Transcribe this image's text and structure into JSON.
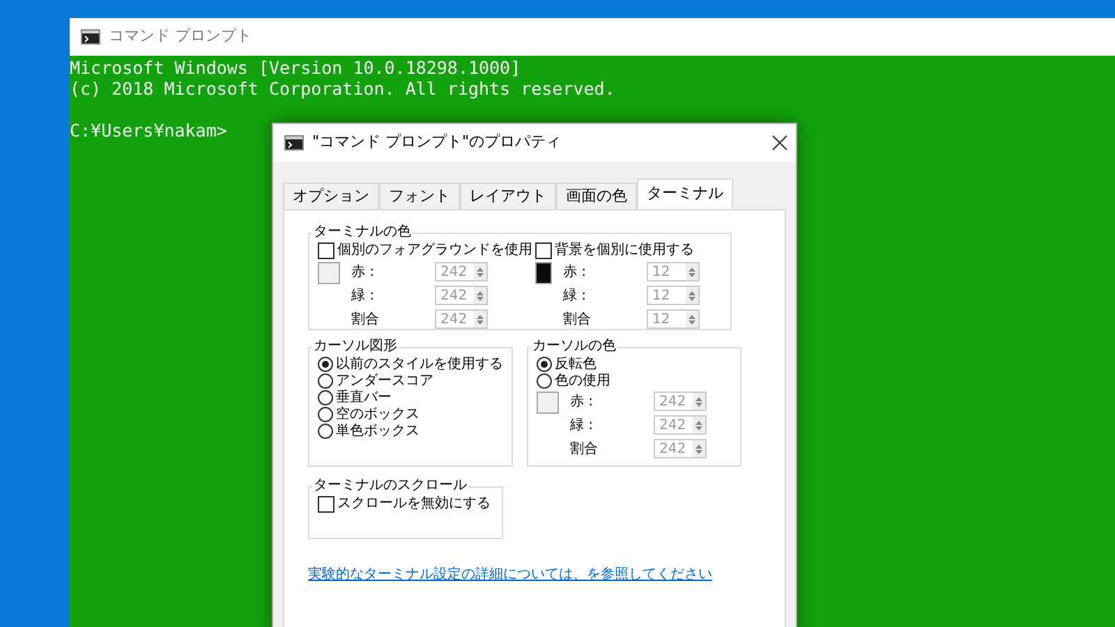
{
  "console": {
    "title": "コマンド プロンプト",
    "output_lines": [
      "Microsoft Windows [Version 10.0.18298.1000]",
      "(c) 2018 Microsoft Corporation. All rights reserved."
    ],
    "prompt": "C:¥Users¥nakam>"
  },
  "dialog": {
    "title": "\"コマンド プロンプト\"のプロパティ",
    "tabs": [
      {
        "label": "オプション",
        "selected": false
      },
      {
        "label": "フォント",
        "selected": false
      },
      {
        "label": "レイアウト",
        "selected": false
      },
      {
        "label": "画面の色",
        "selected": false
      },
      {
        "label": "ターミナル",
        "selected": true
      }
    ],
    "terminal_colors": {
      "title": "ターミナルの色",
      "columns": [
        {
          "label": "個別のフォアグラウンドを使用",
          "checked": false,
          "color": "#f0f0f0",
          "fields": [
            {
              "label": "赤 :",
              "value": "242"
            },
            {
              "label": "緑 :",
              "value": "242"
            },
            {
              "label": "割合",
              "value": "242"
            }
          ]
        },
        {
          "label": "背景を個別に使用する",
          "checked": false,
          "color": "#0c0c0c",
          "fields": [
            {
              "label": "赤 :",
              "value": "12"
            },
            {
              "label": "緑 :",
              "value": "12"
            },
            {
              "label": "割合",
              "value": "12"
            }
          ]
        }
      ]
    },
    "cursor_shape": {
      "title": "カーソル図形",
      "options": [
        {
          "label": "以前のスタイルを使用する",
          "selected": true
        },
        {
          "label": "アンダースコア",
          "selected": false
        },
        {
          "label": "垂直バー",
          "selected": false
        },
        {
          "label": "空のボックス",
          "selected": false
        },
        {
          "label": "単色ボックス",
          "selected": false
        }
      ]
    },
    "cursor_color": {
      "title": "カーソルの色",
      "options": [
        {
          "label": "反転色",
          "selected": true
        },
        {
          "label": "色の使用",
          "selected": false
        }
      ],
      "color": "#f0f0f0",
      "fields": [
        {
          "label": "赤 :",
          "value": "242"
        },
        {
          "label": "緑 :",
          "value": "242"
        },
        {
          "label": "割合",
          "value": "242"
        }
      ]
    },
    "scroll": {
      "title": "ターミナルのスクロール",
      "label": "スクロールを無効にする",
      "checked": false
    },
    "link": "実験的なターミナル設定の詳細については、を参照してください"
  }
}
